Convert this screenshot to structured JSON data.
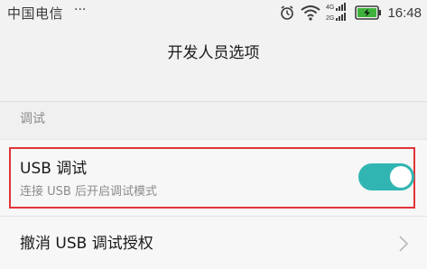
{
  "status_bar": {
    "carrier": "中国电信",
    "more": "···",
    "network_type_top": "4G",
    "network_type_bottom": "2G",
    "time": "16:48",
    "icons": [
      "alarm-icon",
      "wifi-icon",
      "signal-icon",
      "battery-charging-icon"
    ]
  },
  "header": {
    "title": "开发人员选项"
  },
  "section": {
    "label": "调试"
  },
  "usb_debugging": {
    "title": "USB 调试",
    "subtitle": "连接 USB 后开启调试模式",
    "enabled": true,
    "highlighted": true
  },
  "revoke_usb_auth": {
    "label": "撤消 USB 调试授权"
  },
  "colors": {
    "accent": "#30b5b2",
    "highlight_border": "#e0353a",
    "battery_fill": "#3fb23c"
  }
}
